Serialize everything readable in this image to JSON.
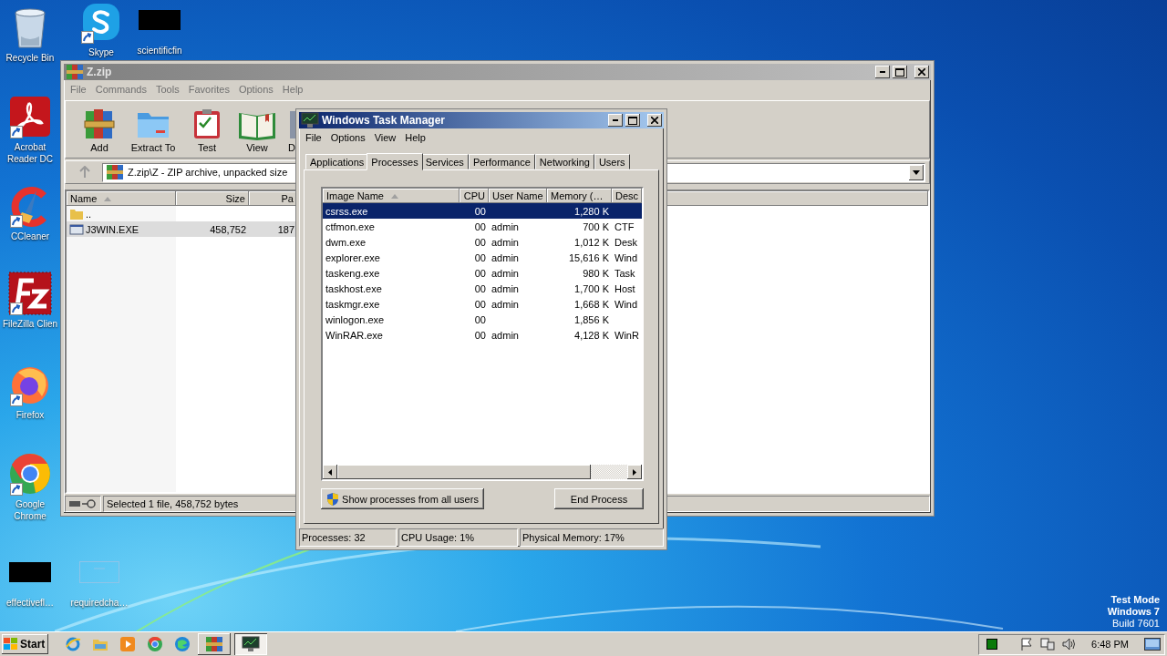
{
  "desktop_icons": [
    {
      "label": "Recycle Bin",
      "kind": "recycle-bin",
      "shortcut": false
    },
    {
      "label": "Skype",
      "kind": "skype",
      "shortcut": true
    },
    {
      "label": "scientificfin",
      "kind": "redacted",
      "shortcut": false
    },
    {
      "label": "Acrobat Reader DC",
      "kind": "acrobat",
      "shortcut": true
    },
    {
      "label": "CCleaner",
      "kind": "ccleaner",
      "shortcut": true
    },
    {
      "label": "FileZilla Clien",
      "kind": "filezilla",
      "shortcut": true
    },
    {
      "label": "Firefox",
      "kind": "firefox",
      "shortcut": true
    },
    {
      "label": "Google Chrome",
      "kind": "chrome",
      "shortcut": true
    },
    {
      "label": "effectivefl…",
      "kind": "redacted",
      "shortcut": false
    },
    {
      "label": "requiredcha…",
      "kind": "blank-file",
      "shortcut": false
    }
  ],
  "winrar": {
    "title": "Z.zip",
    "menu": [
      "File",
      "Commands",
      "Tools",
      "Favorites",
      "Options",
      "Help"
    ],
    "toolbar": [
      {
        "label": "Add",
        "kind": "add"
      },
      {
        "label": "Extract To",
        "kind": "extract"
      },
      {
        "label": "Test",
        "kind": "test"
      },
      {
        "label": "View",
        "kind": "view"
      },
      {
        "label": "D",
        "kind": "delete"
      }
    ],
    "address": "Z.zip\\Z - ZIP archive, unpacked size",
    "columns": [
      "Name",
      "Size",
      "Pa"
    ],
    "rows": [
      {
        "name": "..",
        "kind": "folder",
        "selected": false
      },
      {
        "name": "J3WIN.EXE",
        "size": "458,752",
        "packed": "187",
        "kind": "exe",
        "selected": true
      }
    ],
    "status": "Selected 1 file, 458,752 bytes"
  },
  "task_manager": {
    "title": "Windows Task Manager",
    "menu": [
      "File",
      "Options",
      "View",
      "Help"
    ],
    "tabs": [
      {
        "label": "Applications",
        "selected": false
      },
      {
        "label": "Processes",
        "selected": true
      },
      {
        "label": "Services",
        "selected": false
      },
      {
        "label": "Performance",
        "selected": false
      },
      {
        "label": "Networking",
        "selected": false
      },
      {
        "label": "Users",
        "selected": false
      }
    ],
    "columns": [
      "Image Name",
      "CPU",
      "User Name",
      "Memory (…",
      "Desc"
    ],
    "rows": [
      {
        "image_name": "csrss.exe",
        "cpu": "00",
        "memory": "1,280 K",
        "selected": true
      },
      {
        "image_name": "ctfmon.exe",
        "cpu": "00",
        "user_name": "admin",
        "memory": "700 K",
        "description": "CTF",
        "selected": false
      },
      {
        "image_name": "dwm.exe",
        "cpu": "00",
        "user_name": "admin",
        "memory": "1,012 K",
        "description": "Desk",
        "selected": false
      },
      {
        "image_name": "explorer.exe",
        "cpu": "00",
        "user_name": "admin",
        "memory": "15,616 K",
        "description": "Wind",
        "selected": false
      },
      {
        "image_name": "taskeng.exe",
        "cpu": "00",
        "user_name": "admin",
        "memory": "980 K",
        "description": "Task",
        "selected": false
      },
      {
        "image_name": "taskhost.exe",
        "cpu": "00",
        "user_name": "admin",
        "memory": "1,700 K",
        "description": "Host",
        "selected": false
      },
      {
        "image_name": "taskmgr.exe",
        "cpu": "00",
        "user_name": "admin",
        "memory": "1,668 K",
        "description": "Wind",
        "selected": false
      },
      {
        "image_name": "winlogon.exe",
        "cpu": "00",
        "memory": "1,856 K",
        "selected": false
      },
      {
        "image_name": "WinRAR.exe",
        "cpu": "00",
        "user_name": "admin",
        "memory": "4,128 K",
        "description": "WinR",
        "selected": false
      }
    ],
    "buttons": [
      {
        "label": "Show processes from all users",
        "kind": "shield"
      },
      {
        "label": "End Process",
        "kind": "plain"
      }
    ],
    "status": [
      "Processes: 32",
      "CPU Usage: 1%",
      "Physical Memory: 17%"
    ]
  },
  "os_notice": [
    {
      "text": "Test Mode",
      "bold": true
    },
    {
      "text": "Windows 7",
      "bold": true
    },
    {
      "text": "Build 7601",
      "bold": false
    }
  ],
  "taskbar": {
    "start": "Start",
    "apps": [
      {
        "kind": "internet-explorer",
        "running": false,
        "selected": false
      },
      {
        "kind": "file-explorer",
        "running": false,
        "selected": false
      },
      {
        "kind": "media-player",
        "running": false,
        "selected": false
      },
      {
        "kind": "chrome",
        "running": false,
        "selected": false
      },
      {
        "kind": "edge",
        "running": false,
        "selected": false
      },
      {
        "kind": "winrar",
        "running": true,
        "selected": false
      },
      {
        "kind": "task-manager",
        "running": true,
        "selected": true
      }
    ],
    "clock": "6:48 PM"
  }
}
